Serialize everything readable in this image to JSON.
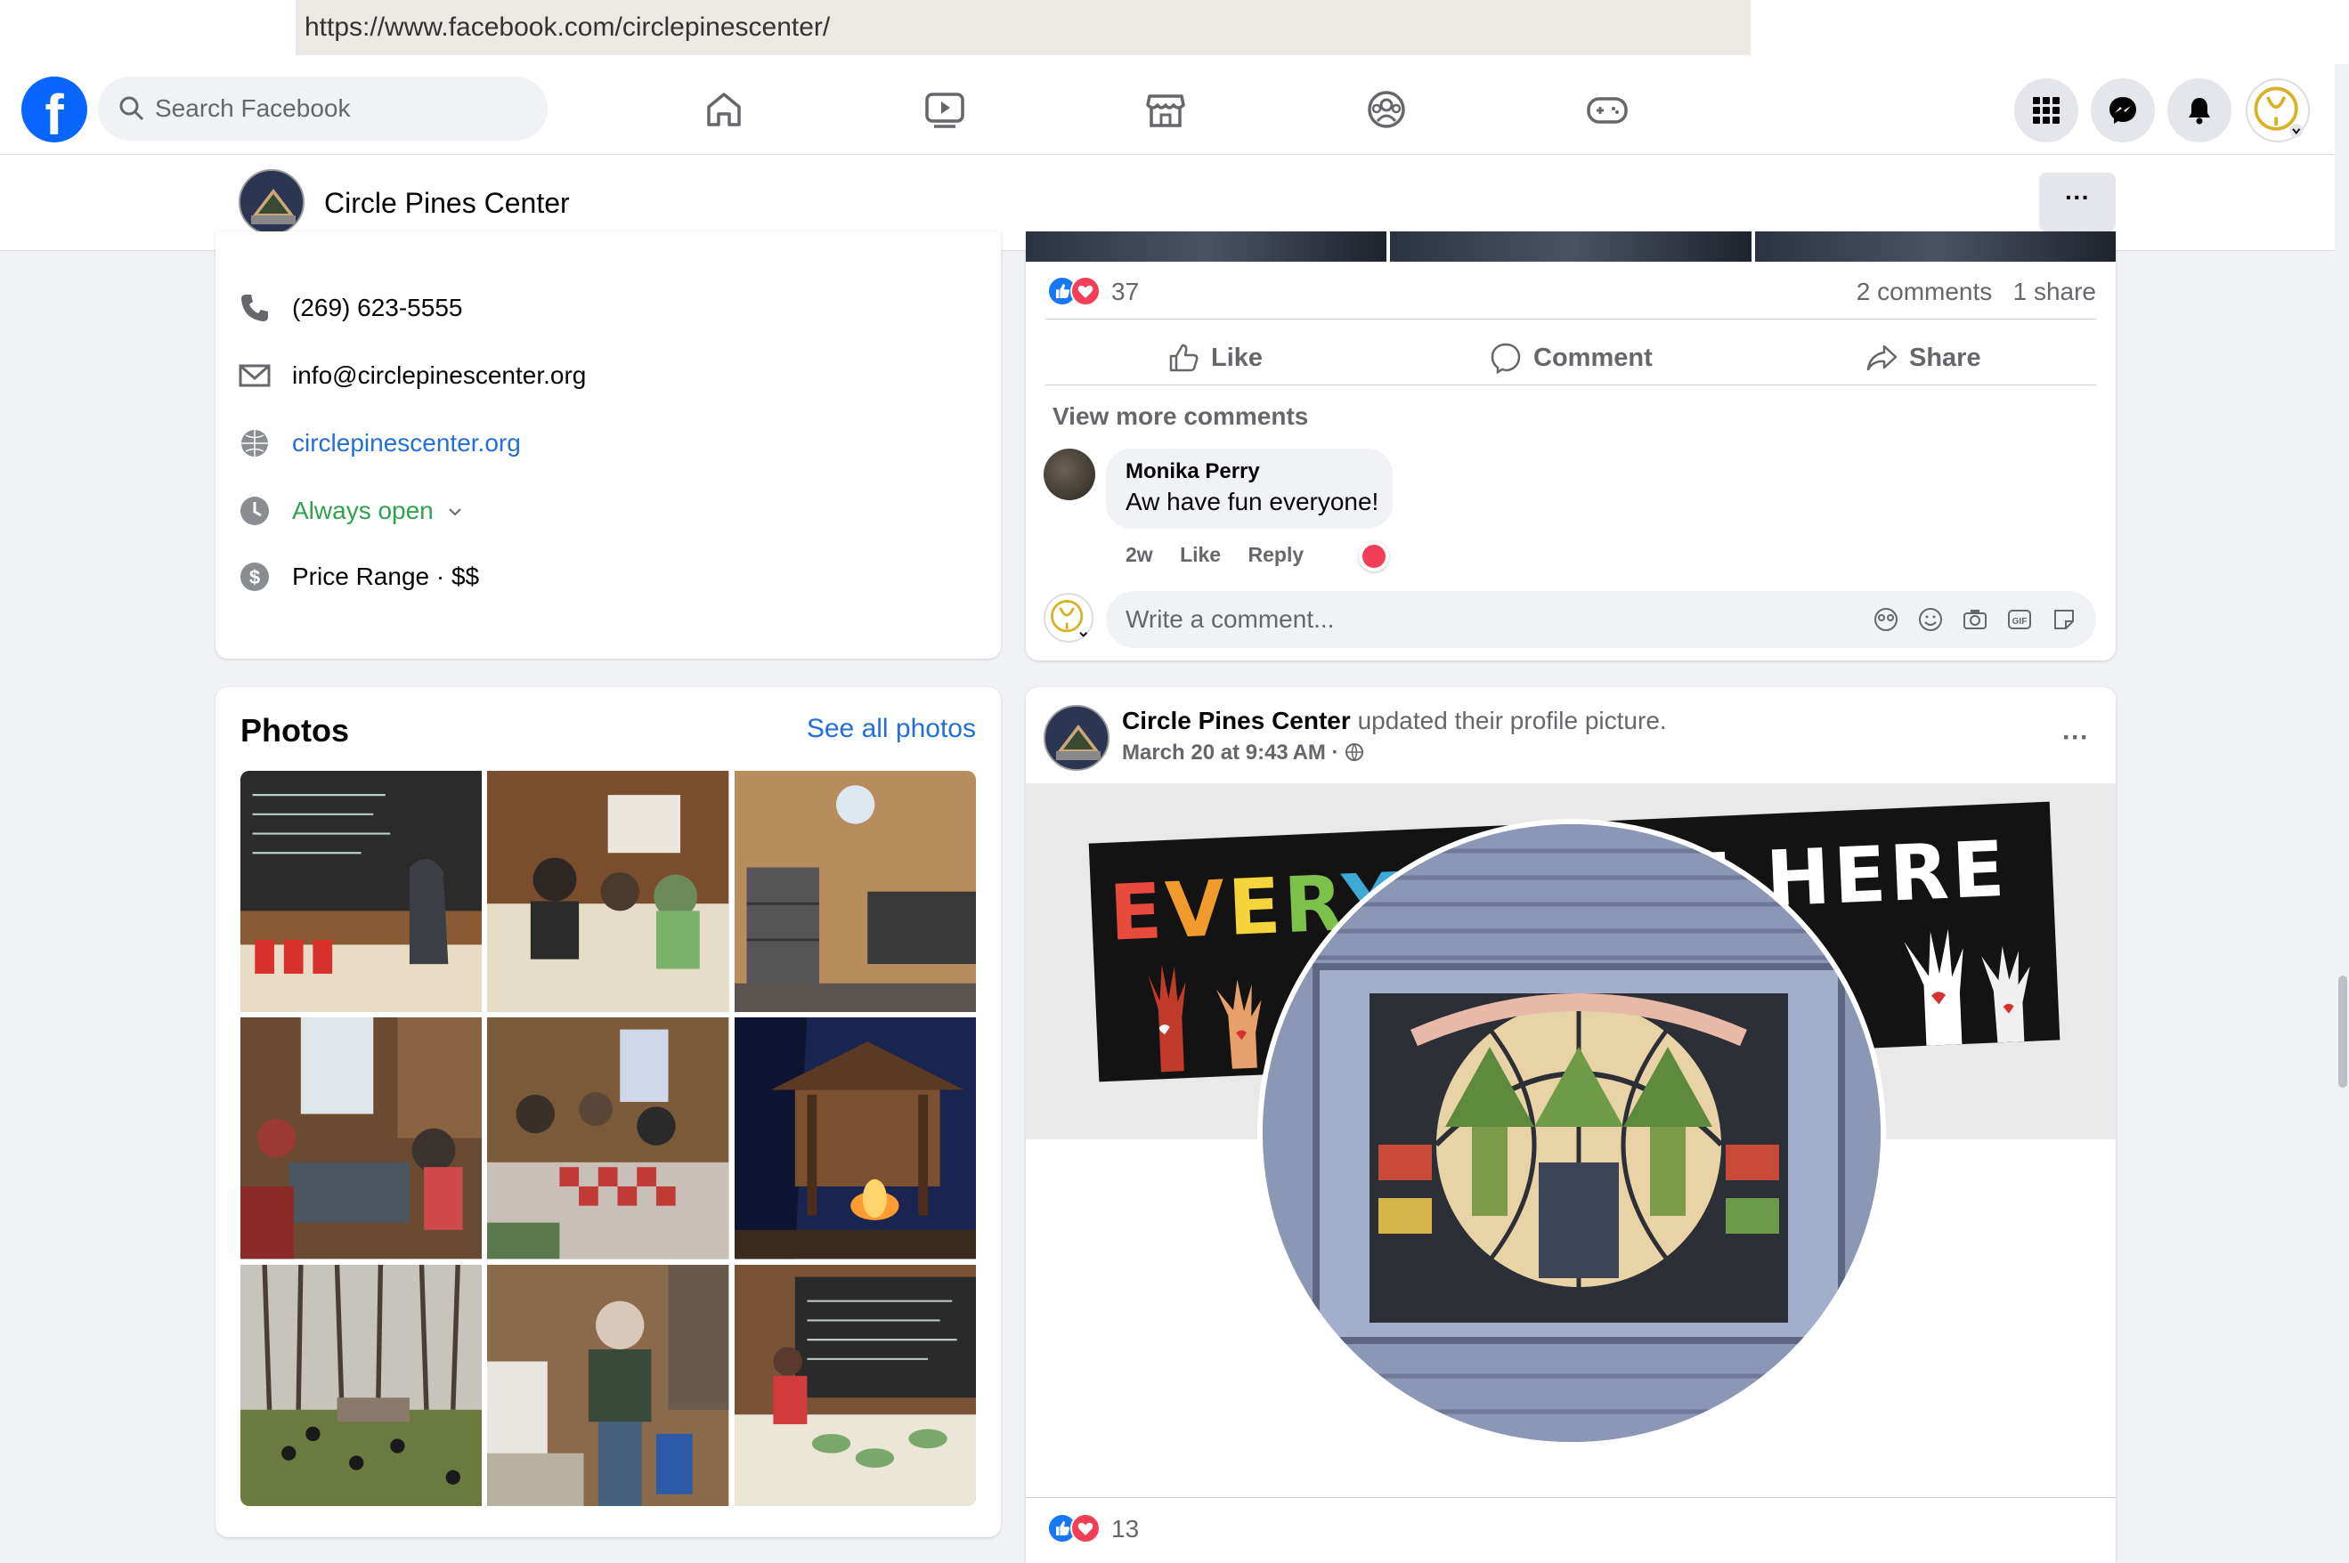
{
  "browser": {
    "url": "https://www.facebook.com/circlepinescenter/"
  },
  "nav": {
    "logo": "f",
    "search_placeholder": "Search Facebook",
    "icons": [
      "home-icon",
      "video-icon",
      "marketplace-icon",
      "groups-icon",
      "gaming-icon"
    ],
    "right_icons": [
      "menu-grid-icon",
      "messenger-icon",
      "bell-icon"
    ]
  },
  "page": {
    "name": "Circle Pines Center",
    "more": "···"
  },
  "intro": {
    "phone": "(269) 623-5555",
    "email": "info@circlepinescenter.org",
    "website": "circlepinescenter.org",
    "hours": "Always open",
    "price": "Price Range · $$"
  },
  "photos": {
    "title": "Photos",
    "see_all": "See all photos"
  },
  "post1": {
    "reaction_count": "37",
    "stats": "2 comments   1 share",
    "actions": {
      "like": "Like",
      "comment": "Comment",
      "share": "Share"
    },
    "view_more": "View more comments",
    "comment": {
      "author": "Monika Perry",
      "text": "Aw have fun everyone!",
      "time": "2w",
      "like": "Like",
      "reply": "Reply"
    },
    "write_placeholder": "Write a comment..."
  },
  "post2": {
    "author": "Circle Pines Center",
    "action": "updated their profile picture.",
    "date": "March 20 at 9:43 AM ·",
    "more": "···",
    "banner_left": "EVERYON",
    "banner_right": "OME HERE",
    "reaction_count": "13"
  },
  "colors": {
    "brand": "#0866ff",
    "link": "#216fdb",
    "open_green": "#31a24c",
    "like_blue": "#1877f2",
    "love_red": "#f33e58"
  }
}
